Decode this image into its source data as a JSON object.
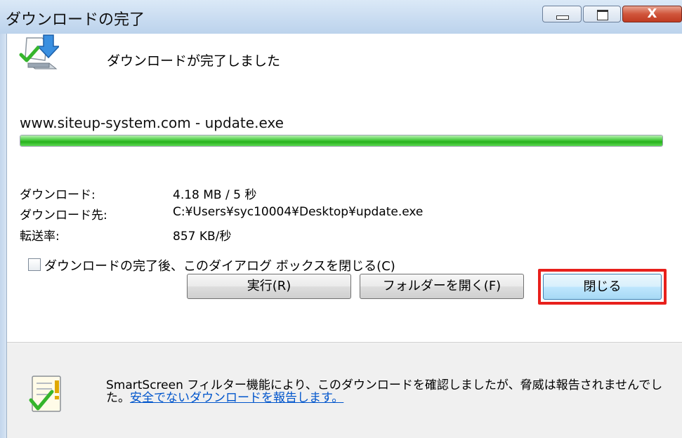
{
  "window": {
    "title": "ダウンロードの完了",
    "close_glyph": "X"
  },
  "status": {
    "message": "ダウンロードが完了しました",
    "source": "www.siteup-system.com - update.exe",
    "progress_percent": 100
  },
  "details": [
    {
      "label": "ダウンロード:",
      "value": "4.18 MB / 5 秒"
    },
    {
      "label": "ダウンロード先:",
      "value": "C:¥Users¥syc10004¥Desktop¥update.exe"
    },
    {
      "label": "転送率:",
      "value": "857 KB/秒"
    }
  ],
  "close_on_complete": {
    "label": "ダウンロードの完了後、このダイアログ ボックスを閉じる(C)",
    "checked": false
  },
  "buttons": {
    "run": "実行(R)",
    "open_folder": "フォルダーを開く(F)",
    "close": "閉じる"
  },
  "smartscreen": {
    "text": "SmartScreen フィルター機能により、このダウンロードを確認しましたが、脅威は報告されませんでした。",
    "link": "安全でないダウンロードを報告します。"
  },
  "colors": {
    "progress_green": "#25b11b",
    "highlight_red": "#e8201c",
    "link_blue": "#0055cc"
  }
}
